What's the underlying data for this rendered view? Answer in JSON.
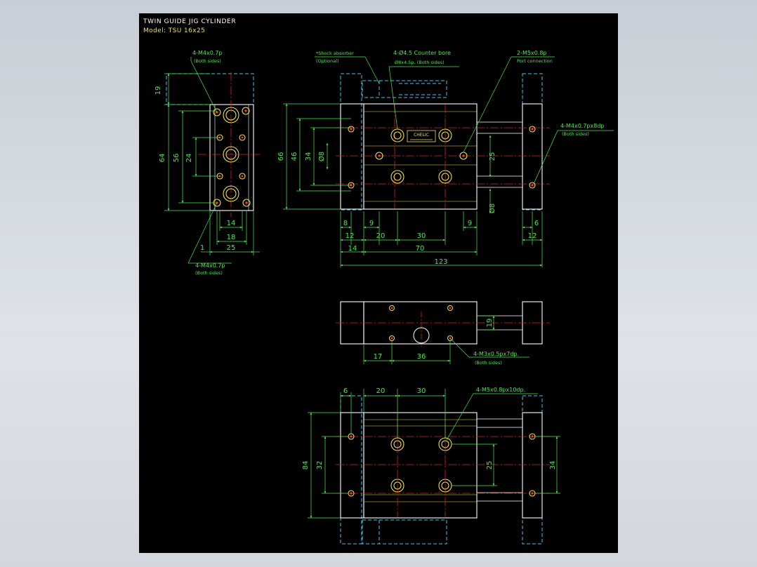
{
  "title_block": {
    "title": "TWIN GUIDE JIG CYLINDER",
    "model": "Model: TSU 16x25"
  },
  "notes": {
    "side_top_thread": "4-M4x0.7p",
    "side_top_both": "(Both sides)",
    "side_bottom_thread": "4-M4x0.7p",
    "side_bottom_both": "(Both sides)",
    "shock_absorber": "*Shock absorber",
    "shock_optional": "(Optional)",
    "counter_bore": "4-Ø4.5 Counter bore",
    "counter_bore_depth": "Ø8x4.5p. (Both sides)",
    "port": "2-M5x0.8p",
    "port_sub": "Port connection",
    "right_thread": "4-M4x0.7px8dp",
    "right_both": "(Both sides)",
    "mid_thread": "4-M3x0.5px7dp.",
    "mid_both": "(Both sides)",
    "bottom_thread": "4-M5x0.8px10dp.",
    "brand_label": "CHELIC"
  },
  "dims": {
    "side_19": "19",
    "side_64": "64",
    "side_56": "56",
    "side_24": "24",
    "side_14": "14",
    "side_18": "18",
    "side_25": "25",
    "side_1": "1",
    "front_66": "66",
    "front_46": "46",
    "front_34": "34",
    "front_d8a": "Ø8",
    "front_25": "25",
    "front_d8b": "Ø8",
    "front_8": "8",
    "front_9a": "9",
    "front_9b": "9",
    "front_6": "6",
    "front_12a": "12",
    "front_20": "20",
    "front_30": "30",
    "front_12b": "12",
    "front_14": "14",
    "front_70": "70",
    "front_123": "123",
    "mid_19": "19",
    "mid_17": "17",
    "mid_36": "36",
    "bot_6": "6",
    "bot_20": "20",
    "bot_30": "30",
    "bot_84": "84",
    "bot_32": "32",
    "bot_25": "25",
    "bot_34": "34"
  },
  "colors": {
    "sheet": "#000000",
    "outline": "#ffffff",
    "dimension": "#4ee84e",
    "centerline": "#e02020",
    "hidden": "#3ec8f0",
    "hole": "#f0e050",
    "hole_core": "#ff3a1a"
  }
}
